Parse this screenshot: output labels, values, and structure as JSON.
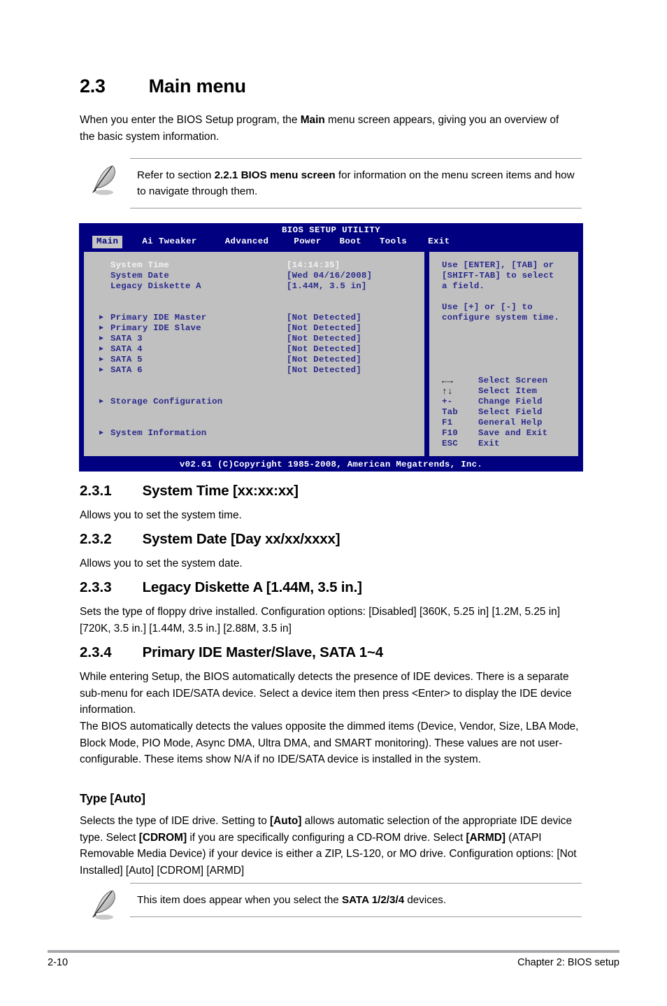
{
  "section": {
    "number": "2.3",
    "title": "Main menu",
    "intro_a": "When you enter the BIOS Setup program, the ",
    "intro_b": "Main",
    "intro_c": " menu screen appears, giving you an overview of the basic system information."
  },
  "note_top": {
    "icon": "quill-pen-icon",
    "text_a": "Refer to section ",
    "text_b": "2.2.1 BIOS menu screen",
    "text_c": " for information on the menu screen items and how to navigate through them."
  },
  "bios": {
    "title": "BIOS SETUP UTILITY",
    "tabs": [
      {
        "label": "Main",
        "active": true
      },
      {
        "label": "Ai Tweaker",
        "active": false
      },
      {
        "label": "Advanced",
        "active": false
      },
      {
        "label": "Power",
        "active": false
      },
      {
        "label": "Boot",
        "active": false
      },
      {
        "label": "Tools",
        "active": false
      },
      {
        "label": "Exit",
        "active": false
      }
    ],
    "settings": [
      {
        "label": "System Time",
        "value": "[14:14:35]",
        "arrow": "",
        "selected": true
      },
      {
        "label": "System Date",
        "value": "[Wed 04/16/2008]",
        "arrow": "",
        "selected": false
      },
      {
        "label": "Legacy Diskette A",
        "value": "[1.44M, 3.5 in]",
        "arrow": "",
        "selected": false
      }
    ],
    "devices": [
      {
        "label": "Primary IDE Master",
        "value": "[Not Detected]",
        "arrow": "▶"
      },
      {
        "label": "Primary IDE Slave",
        "value": "[Not Detected]",
        "arrow": "▶"
      },
      {
        "label": "SATA 3",
        "value": "[Not Detected]",
        "arrow": "▶"
      },
      {
        "label": "SATA 4",
        "value": "[Not Detected]",
        "arrow": "▶"
      },
      {
        "label": "SATA 5",
        "value": "[Not Detected]",
        "arrow": "▶"
      },
      {
        "label": "SATA 6",
        "value": "[Not Detected]",
        "arrow": "▶"
      }
    ],
    "submenus": [
      {
        "label": "Storage Configuration",
        "arrow": "▶"
      },
      {
        "label": "System Information",
        "arrow": "▶"
      }
    ],
    "help": {
      "paragraph1": "Use [ENTER], [TAB] or\n[SHIFT-TAB] to select\na field.",
      "paragraph2": "Use [+] or [-] to\nconfigure system time.",
      "keys": [
        {
          "key": "←→",
          "action": "Select Screen",
          "glyph": true
        },
        {
          "key": "↑↓",
          "action": "Select Item",
          "glyph": true
        },
        {
          "key": "+-",
          "action": "Change Field",
          "glyph": false
        },
        {
          "key": "Tab",
          "action": "Select Field",
          "glyph": false
        },
        {
          "key": "F1",
          "action": "General Help",
          "glyph": false
        },
        {
          "key": "F10",
          "action": "Save and Exit",
          "glyph": false
        },
        {
          "key": "ESC",
          "action": "Exit",
          "glyph": false
        }
      ]
    },
    "footer": "v02.61 (C)Copyright 1985-2008, American Megatrends, Inc.",
    "colors": {
      "chrome_blue": "#000080",
      "panel_gray": "#c0c0c0",
      "text_blue": "#2b2b8c",
      "selected_text": "#f2f2f2"
    }
  },
  "subsections": [
    {
      "number": "2.3.1",
      "title": "System Time [xx:xx:xx]",
      "body": "Allows you to set the system time."
    },
    {
      "number": "2.3.2",
      "title": "System Date [Day xx/xx/xxxx]",
      "body": "Allows you to set the system date."
    },
    {
      "number": "2.3.3",
      "title": "Legacy Diskette A [1.44M, 3.5 in.]",
      "body": "Sets the type of floppy drive installed. Configuration options: [Disabled] [360K, 5.25 in] [1.2M, 5.25 in] [720K, 3.5 in.] [1.44M, 3.5 in.] [2.88M, 3.5 in]"
    },
    {
      "number": "2.3.4",
      "title": "Primary IDE Master/Slave, SATA 1~4",
      "body_p1": "While entering Setup, the BIOS automatically detects the presence of IDE devices. There is a separate sub-menu for each IDE/SATA device. Select a device item then press <Enter> to display the IDE device information.",
      "body_p2": "The BIOS automatically detects the values opposite the dimmed items (Device, Vendor, Size, LBA Mode, Block Mode, PIO Mode, Async DMA, Ultra DMA, and SMART monitoring). These values are not user-configurable. These items show N/A if no IDE/SATA device is installed in the system."
    }
  ],
  "type_block": {
    "heading": "Type [Auto]",
    "t1": "Selects the type of IDE drive. Setting to ",
    "t2": "[Auto]",
    "t3": " allows automatic selection of the appropriate IDE device type. Select ",
    "t4": "[CDROM]",
    "t5": " if you are specifically configuring a CD-ROM drive. Select ",
    "t6": "[ARMD]",
    "t7": " (ATAPI Removable Media Device) if your device is either a ZIP, LS-120, or MO drive. Configuration options: [Not Installed] [Auto] [CDROM] [ARMD]"
  },
  "note_bottom": {
    "icon": "quill-pen-icon",
    "text_a": "This item does appear when you select the ",
    "text_b": "SATA 1/2/3/4",
    "text_c": " devices."
  },
  "footer": {
    "page_number": "2-10",
    "chapter": "Chapter 2: BIOS setup"
  }
}
